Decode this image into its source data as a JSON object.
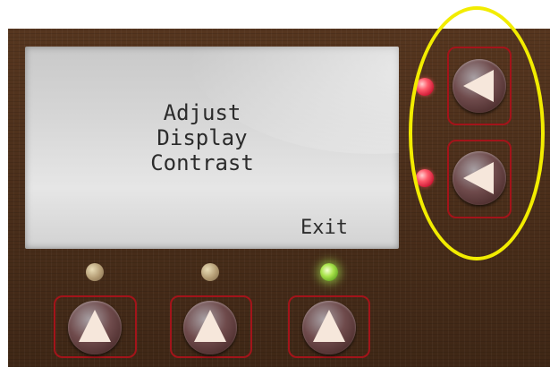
{
  "screen": {
    "message_lines": [
      "Adjust",
      "Display",
      "Contrast"
    ],
    "exit_label": "Exit",
    "scroll_up_glyph": "▲",
    "scroll_down_glyph": "▼"
  },
  "indicators": {
    "right_top": "red",
    "right_bottom": "red",
    "bottom_1": "off",
    "bottom_2": "off",
    "bottom_3": "green"
  },
  "buttons": {
    "right": [
      {
        "name": "right-top-button",
        "icon": "triangle-left-icon"
      },
      {
        "name": "right-bottom-button",
        "icon": "triangle-left-icon"
      }
    ],
    "bottom": [
      {
        "name": "bottom-button-1",
        "icon": "triangle-up-icon"
      },
      {
        "name": "bottom-button-2",
        "icon": "triangle-up-icon"
      },
      {
        "name": "bottom-button-3",
        "icon": "triangle-up-icon"
      }
    ]
  },
  "colors": {
    "panel": "#4a2f1b",
    "highlight": "#f2ec00",
    "button_frame": "#a3141a"
  }
}
